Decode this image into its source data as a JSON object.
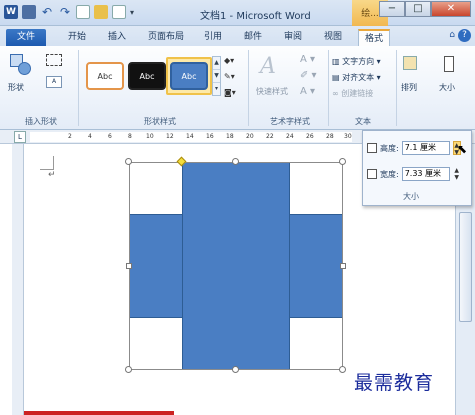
{
  "window": {
    "title": "文档1 - Microsoft Word",
    "context_tab": "绘...",
    "buttons": {
      "minimize": "−",
      "maximize": "□",
      "close": "✕"
    }
  },
  "qat": {
    "word": "W",
    "undo": "↶",
    "redo": "↷",
    "dropdown": "▾"
  },
  "tabs": [
    {
      "label": "文件",
      "active": false
    },
    {
      "label": "开始",
      "active": false
    },
    {
      "label": "插入",
      "active": false
    },
    {
      "label": "页面布局",
      "active": false
    },
    {
      "label": "引用",
      "active": false
    },
    {
      "label": "邮件",
      "active": false
    },
    {
      "label": "审阅",
      "active": false
    },
    {
      "label": "视图",
      "active": false
    },
    {
      "label": "格式",
      "active": true
    }
  ],
  "tab_help": {
    "caret": "⌂",
    "question": "?"
  },
  "ribbon": {
    "insert_shapes": {
      "shapes_label": "形状",
      "group_label": "插入形状"
    },
    "shape_styles": {
      "group_label": "形状样式",
      "styles": [
        "Abc",
        "Abc",
        "Abc"
      ],
      "selected_index": 2
    },
    "wordart": {
      "quick_styles": "快速样式",
      "letter": "A",
      "group_label": "艺术字样式"
    },
    "text": {
      "direction": "文字方向",
      "align": "对齐文本",
      "link": "创建链接",
      "group_label": "文本"
    },
    "arrange": {
      "label": "排列"
    },
    "size": {
      "label": "大小"
    }
  },
  "size_popup": {
    "height_label": "高度:",
    "height_value": "7.1 厘米",
    "width_label": "宽度:",
    "width_value": "7.33 厘米",
    "group_label": "大小"
  },
  "ruler": {
    "box": "L",
    "ticks": [
      "2",
      "4",
      "6",
      "8",
      "10",
      "12",
      "14",
      "16",
      "18",
      "20",
      "22",
      "24",
      "26",
      "28",
      "30"
    ]
  },
  "document": {
    "paragraph_mark": "↵"
  },
  "watermark": "最需教育",
  "colors": {
    "shape_fill": "#4a7ec3",
    "file_tab": "#1d5ab0",
    "context_tab": "#f1b850"
  }
}
